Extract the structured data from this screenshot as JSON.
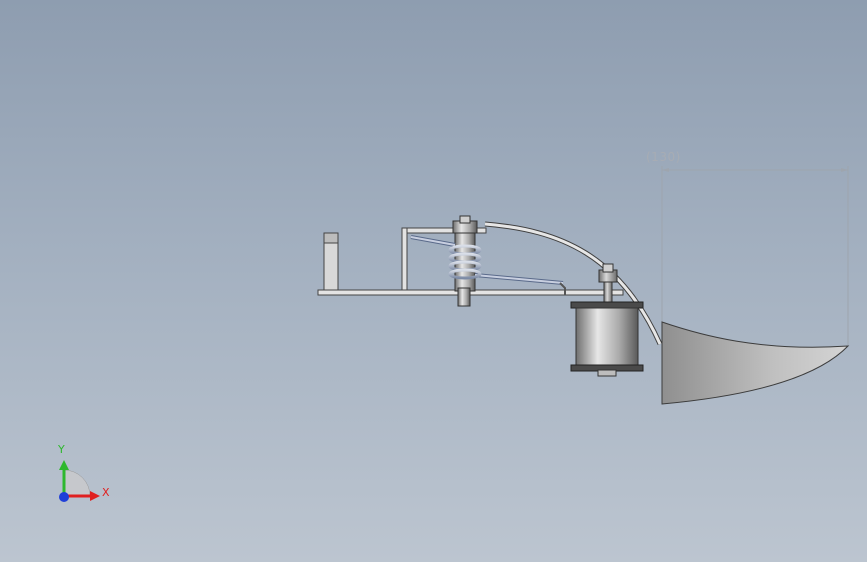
{
  "viewport": {
    "dimension": {
      "value": "(130)"
    },
    "triad": {
      "x_label": "X",
      "y_label": "Y"
    }
  },
  "colors": {
    "background_top": "#8e9db0",
    "background_bottom": "#bcc5d0",
    "dimension_line": "#9ea5ae",
    "x_axis": "#e02020",
    "y_axis": "#2eb82e",
    "z_axis": "#1f3fd8"
  }
}
